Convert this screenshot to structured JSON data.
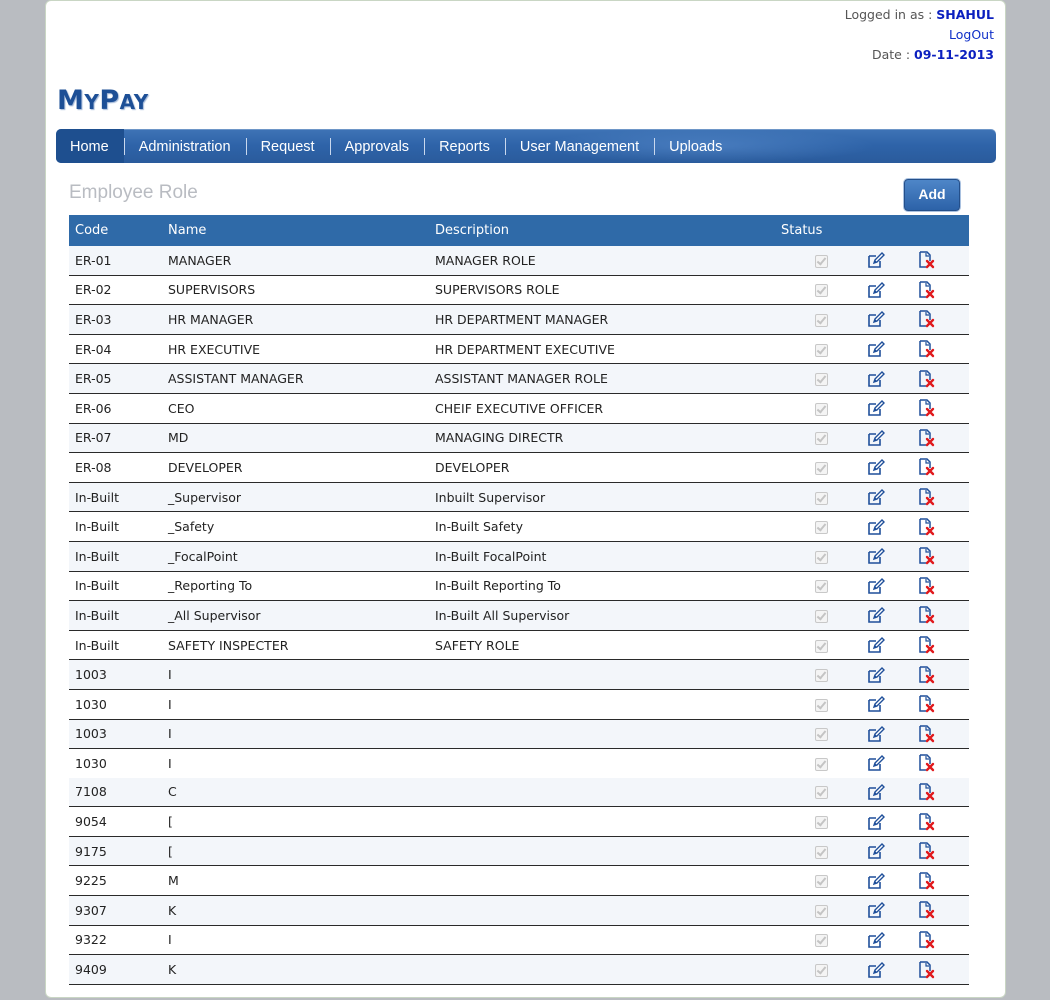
{
  "header": {
    "logged_in_label": "Logged in as : ",
    "username": "SHAHUL",
    "logout_label": "LogOut",
    "date_label": "Date : ",
    "date_value": "09-11-2013"
  },
  "logo": {
    "first_big": "M",
    "first_small": "Y",
    "second_big": "P",
    "second_small": "AY"
  },
  "nav": {
    "items": [
      "Home",
      "Administration",
      "Request",
      "Approvals",
      "Reports",
      "User Management",
      "Uploads"
    ],
    "active": "Home"
  },
  "page": {
    "title": "Employee Role",
    "add_label": "Add"
  },
  "table": {
    "columns": [
      "Code",
      "Name",
      "Description",
      "Status",
      "",
      ""
    ],
    "rows": [
      {
        "code": "ER-01",
        "name": "MANAGER",
        "description": "MANAGER ROLE",
        "status": true
      },
      {
        "code": "ER-02",
        "name": "SUPERVISORS",
        "description": "SUPERVISORS ROLE",
        "status": true
      },
      {
        "code": "ER-03",
        "name": "HR MANAGER",
        "description": "HR DEPARTMENT MANAGER",
        "status": true
      },
      {
        "code": "ER-04",
        "name": "HR EXECUTIVE",
        "description": "HR DEPARTMENT EXECUTIVE",
        "status": true
      },
      {
        "code": "ER-05",
        "name": "ASSISTANT MANAGER",
        "description": "ASSISTANT MANAGER ROLE",
        "status": true
      },
      {
        "code": "ER-06",
        "name": "CEO",
        "description": "CHEIF EXECUTIVE OFFICER",
        "status": true
      },
      {
        "code": "ER-07",
        "name": "MD",
        "description": "MANAGING DIRECTR",
        "status": true
      },
      {
        "code": "ER-08",
        "name": "DEVELOPER",
        "description": "DEVELOPER",
        "status": true
      },
      {
        "code": "In-Built",
        "name": "_Supervisor",
        "description": "Inbuilt Supervisor",
        "status": true
      },
      {
        "code": "In-Built",
        "name": "_Safety",
        "description": "In-Built Safety",
        "status": true
      },
      {
        "code": "In-Built",
        "name": "_FocalPoint",
        "description": "In-Built FocalPoint",
        "status": true
      },
      {
        "code": "In-Built",
        "name": "_Reporting To",
        "description": "In-Built Reporting To",
        "status": true
      },
      {
        "code": "In-Built",
        "name": "_All Supervisor",
        "description": "In-Built All Supervisor",
        "status": true
      },
      {
        "code": "In-Built",
        "name": "SAFETY INSPECTER",
        "description": "SAFETY ROLE",
        "status": true
      },
      {
        "code": "1003",
        "name": "I",
        "description": "",
        "status": true
      },
      {
        "code": "1030",
        "name": "I",
        "description": "",
        "status": true
      },
      {
        "code": "1003",
        "name": "I",
        "description": "",
        "status": true
      },
      {
        "code": "1030",
        "name": "I",
        "description": "",
        "status": true
      },
      {
        "code": "7108",
        "name": "C",
        "description": "",
        "status": true
      },
      {
        "code": "9054",
        "name": "[",
        "description": "",
        "status": true
      },
      {
        "code": "9175",
        "name": "[",
        "description": "",
        "status": true
      },
      {
        "code": "9225",
        "name": "M",
        "description": "",
        "status": true
      },
      {
        "code": "9307",
        "name": "K",
        "description": "",
        "status": true
      },
      {
        "code": "9322",
        "name": "I",
        "description": "",
        "status": true
      },
      {
        "code": "9409",
        "name": "K",
        "description": "",
        "status": true
      }
    ]
  },
  "icons": {
    "edit": "edit-icon",
    "delete": "delete-icon"
  },
  "colors": {
    "nav": "#2f6aa8",
    "header_row": "#2f6aa8",
    "user": "#0b1fbf",
    "logo": "#1d4f96"
  }
}
